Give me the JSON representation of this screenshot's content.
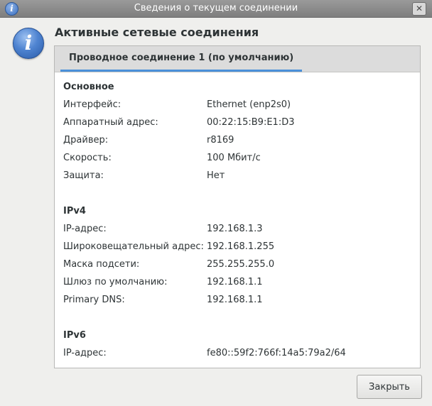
{
  "window": {
    "title": "Сведения о текущем соединении",
    "close_glyph": "✕",
    "icon_glyph": "i"
  },
  "heading": "Активные сетевые соединения",
  "tab": {
    "label": "Проводное соединение 1 (по умолчанию)"
  },
  "sections": {
    "basic": {
      "title": "Основное",
      "rows": [
        {
          "label": "Интерфейс:",
          "value": "Ethernet (enp2s0)"
        },
        {
          "label": "Аппаратный адрес:",
          "value": "00:22:15:B9:E1:D3"
        },
        {
          "label": "Драйвер:",
          "value": "r8169"
        },
        {
          "label": "Скорость:",
          "value": "100 Мбит/с"
        },
        {
          "label": "Защита:",
          "value": "Нет"
        }
      ]
    },
    "ipv4": {
      "title": "IPv4",
      "rows": [
        {
          "label": "IP-адрес:",
          "value": "192.168.1.3"
        },
        {
          "label": "Широковещательный адрес:",
          "value": "192.168.1.255"
        },
        {
          "label": "Маска подсети:",
          "value": "255.255.255.0"
        },
        {
          "label": "Шлюз по умолчанию:",
          "value": "192.168.1.1"
        },
        {
          "label": "Primary DNS:",
          "value": "192.168.1.1"
        }
      ]
    },
    "ipv6": {
      "title": "IPv6",
      "rows": [
        {
          "label": "IP-адрес:",
          "value": "fe80::59f2:766f:14a5:79a2/64"
        }
      ]
    }
  },
  "buttons": {
    "close_label": "Закрыть"
  },
  "icons": {
    "window_icon": "info-icon",
    "dialog_icon": "info-icon",
    "close": "close-icon"
  },
  "colors": {
    "accent": "#4a90d9",
    "titlebar": "#8a8a8a"
  }
}
